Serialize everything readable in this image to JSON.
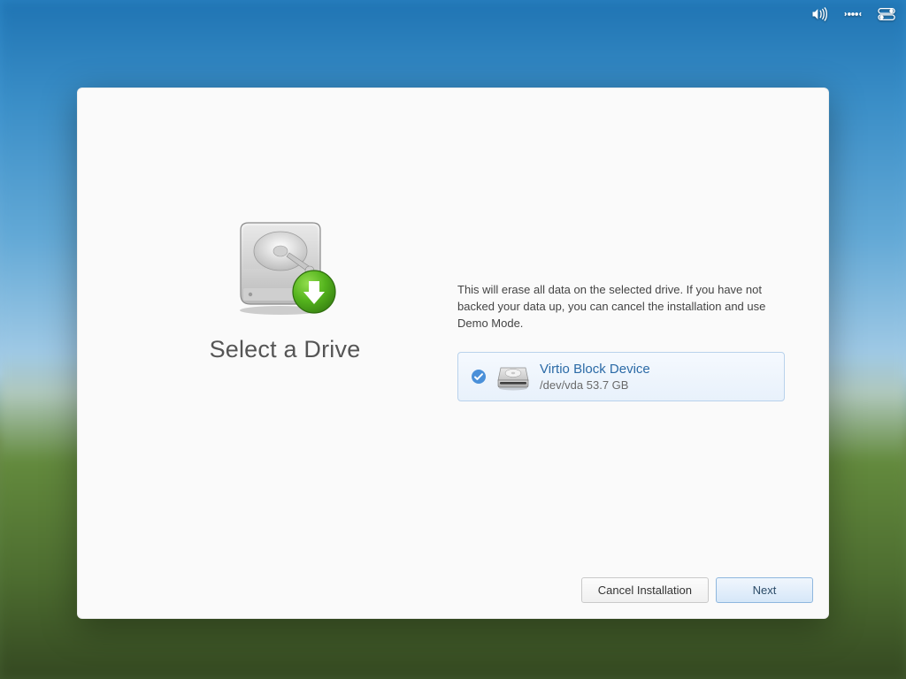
{
  "topbar": {
    "sound_icon": "volume-icon",
    "network_icon": "network-icon",
    "power_icon": "power-toggles-icon"
  },
  "dialog": {
    "title": "Select a Drive",
    "warning": "This will erase all data on the selected drive. If you have not backed your data up, you can cancel the installation and use Demo Mode.",
    "drive": {
      "name": "Virtio Block Device",
      "path_size": "/dev/vda 53.7 GB",
      "selected": true
    },
    "buttons": {
      "cancel": "Cancel Installation",
      "next": "Next"
    }
  },
  "colors": {
    "accent": "#2b6aa6",
    "selection_border": "#b9d2ec"
  }
}
